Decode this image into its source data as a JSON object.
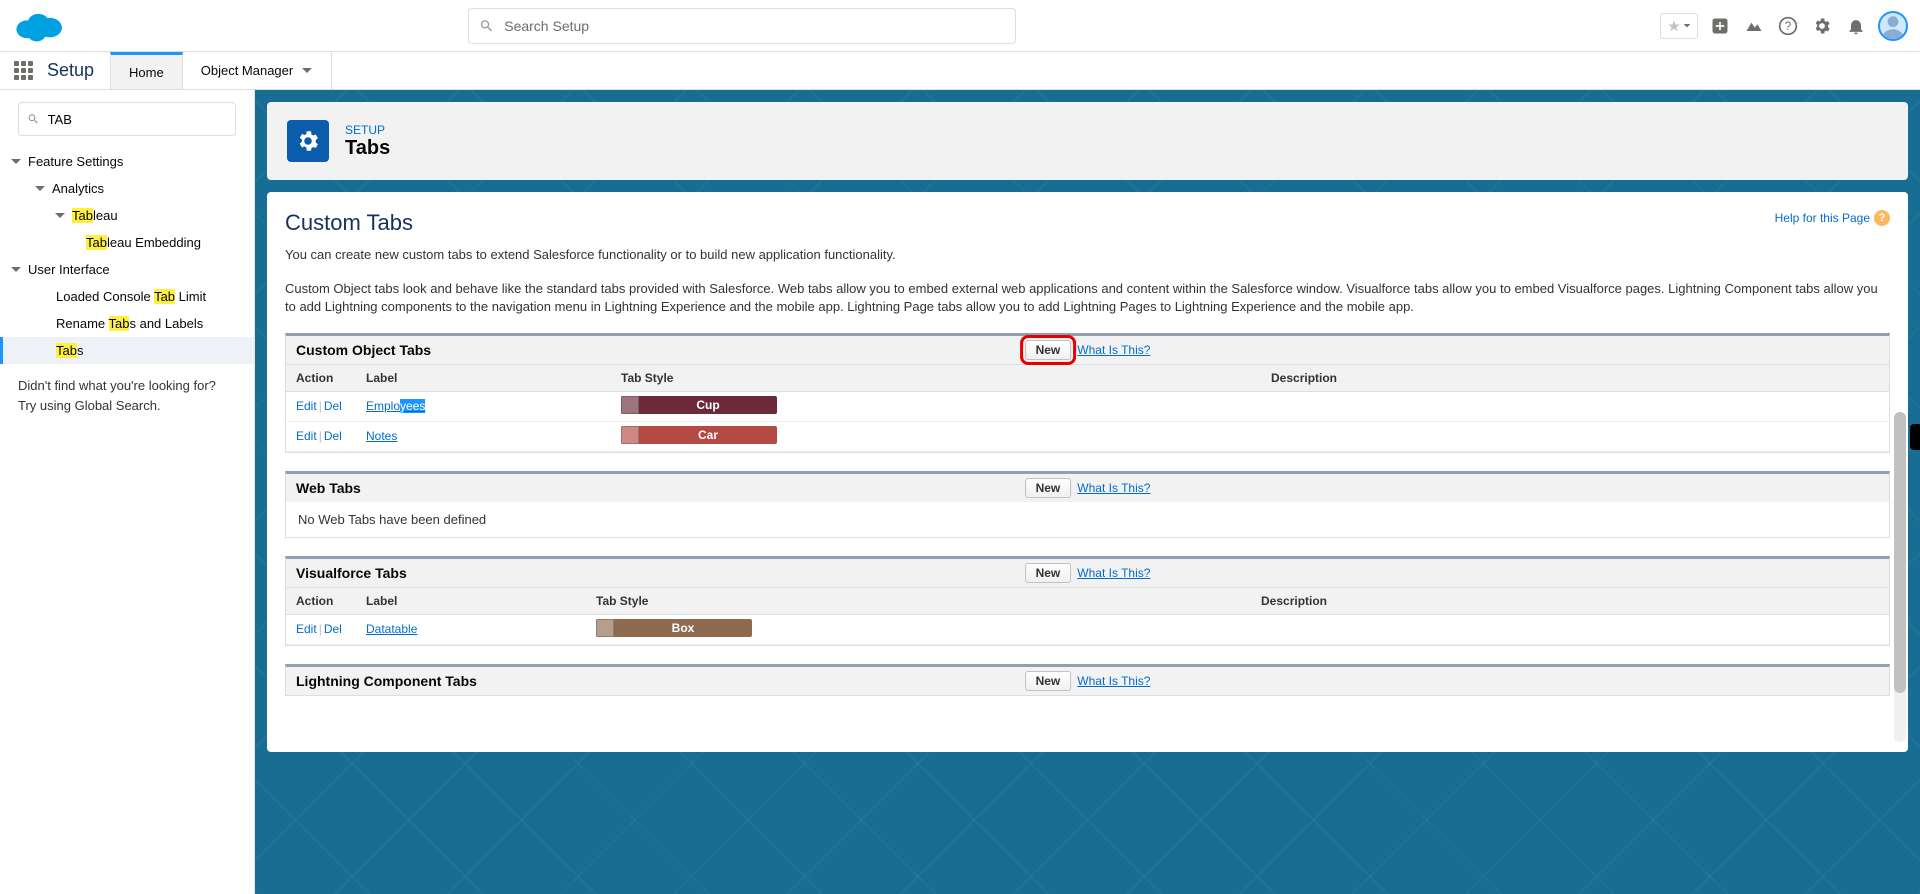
{
  "header": {
    "search_placeholder": "Search Setup"
  },
  "context": {
    "app_name": "Setup",
    "tabs": {
      "home": "Home",
      "object_manager": "Object Manager"
    }
  },
  "sidebar": {
    "quick_find_value": "TAB",
    "feature_settings": "Feature Settings",
    "analytics": "Analytics",
    "tableau_pre": "Tab",
    "tableau_post": "leau",
    "tableau_embed_pre": "Tab",
    "tableau_embed_post": "leau Embedding",
    "user_interface": "User Interface",
    "loaded_pre": "Loaded Console ",
    "loaded_hl": "Tab",
    "loaded_post": " Limit",
    "rename_pre": "Rename ",
    "rename_hl": "Tab",
    "rename_post": "s and Labels",
    "tabs_hl": "Tab",
    "tabs_post": "s",
    "nofind1": "Didn't find what you're looking for?",
    "nofind2": "Try using Global Search."
  },
  "page_header": {
    "crumb": "SETUP",
    "title": "Tabs"
  },
  "body": {
    "heading": "Custom Tabs",
    "help": "Help for this Page",
    "p1": "You can create new custom tabs to extend Salesforce functionality or to build new application functionality.",
    "p2": "Custom Object tabs look and behave like the standard tabs provided with Salesforce. Web tabs allow you to embed external web applications and content within the Salesforce window. Visualforce tabs allow you to embed Visualforce pages. Lightning Component tabs allow you to add Lightning components to the navigation menu in Lightning Experience and the mobile app. Lightning Page tabs allow you to add Lightning Pages to Lightning Experience and the mobile app."
  },
  "sections": {
    "cot": {
      "title": "Custom Object Tabs",
      "new": "New",
      "wit": "What Is This?",
      "cols": {
        "action": "Action",
        "label": "Label",
        "style": "Tab Style",
        "desc": "Description"
      },
      "rows": [
        {
          "edit": "Edit",
          "del": "Del",
          "label_a": "Emplo",
          "label_sel": "yees",
          "label_b": "",
          "style": "Cup",
          "style_color": "#6a2a3a"
        },
        {
          "edit": "Edit",
          "del": "Del",
          "label_a": "Notes",
          "label_sel": "",
          "label_b": "",
          "style": "Car",
          "style_color": "#b44a44"
        }
      ]
    },
    "web": {
      "title": "Web Tabs",
      "new": "New",
      "wit": "What Is This?",
      "empty": "No Web Tabs have been defined"
    },
    "vf": {
      "title": "Visualforce Tabs",
      "new": "New",
      "wit": "What Is This?",
      "cols": {
        "action": "Action",
        "label": "Label",
        "style": "Tab Style",
        "desc": "Description"
      },
      "rows": [
        {
          "edit": "Edit",
          "del": "Del",
          "label": "Datatable",
          "style": "Box",
          "style_color": "#8e6a4f"
        }
      ]
    },
    "lct": {
      "title": "Lightning Component Tabs",
      "new": "New",
      "wit": "What Is This?"
    }
  }
}
